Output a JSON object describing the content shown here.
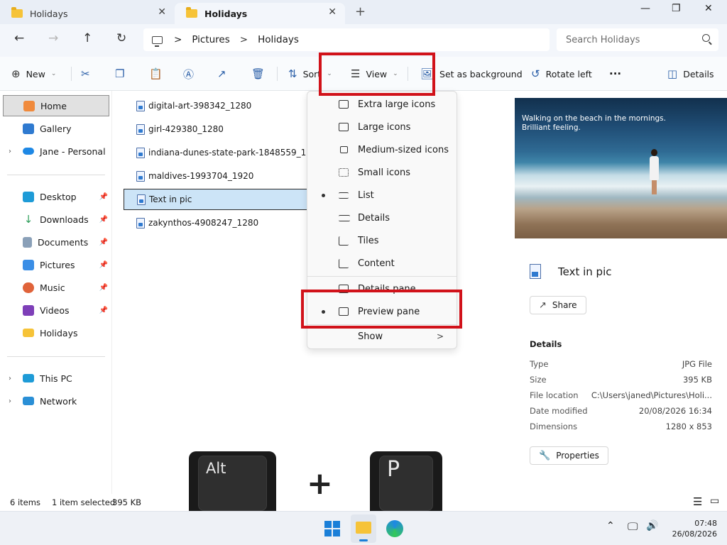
{
  "tabs": [
    {
      "label": "Holidays",
      "active": false
    },
    {
      "label": "Holidays",
      "active": true
    }
  ],
  "tab_controls": {
    "close": "✕",
    "new_tab": "+"
  },
  "window_controls": {
    "minimize": "—",
    "maximize": "❐",
    "close": "✕"
  },
  "nav": {
    "back": "←",
    "forward": "→",
    "up": "↑",
    "refresh": "↻"
  },
  "address": {
    "crumbs": [
      "Pictures",
      "Holidays"
    ],
    "separator": ">"
  },
  "search": {
    "placeholder": "Search Holidays"
  },
  "toolbar": {
    "new_label": "New",
    "sort_label": "Sort",
    "view_label": "View",
    "set_background_label": "Set as background",
    "rotate_left_label": "Rotate left",
    "more_label": "···",
    "details_label": "Details"
  },
  "sidebar": {
    "top": [
      {
        "label": "Home",
        "selected": true
      },
      {
        "label": "Gallery"
      },
      {
        "label": "Jane - Personal",
        "expandable": true
      }
    ],
    "quick_access": [
      {
        "label": "Desktop",
        "pinned": true
      },
      {
        "label": "Downloads",
        "pinned": true
      },
      {
        "label": "Documents",
        "pinned": true
      },
      {
        "label": "Pictures",
        "pinned": true
      },
      {
        "label": "Music",
        "pinned": true
      },
      {
        "label": "Videos",
        "pinned": true
      },
      {
        "label": "Holidays",
        "pinned": false
      }
    ],
    "bottom": [
      {
        "label": "This PC",
        "expandable": true
      },
      {
        "label": "Network",
        "expandable": true
      }
    ]
  },
  "files": [
    {
      "name": "digital-art-398342_1280"
    },
    {
      "name": "girl-429380_1280"
    },
    {
      "name": "indiana-dunes-state-park-1848559_1280"
    },
    {
      "name": "maldives-1993704_1920"
    },
    {
      "name": "Text in pic",
      "selected": true
    },
    {
      "name": "zakynthos-4908247_1280"
    }
  ],
  "view_menu": {
    "items": [
      {
        "label": "Extra large icons",
        "bullet": false
      },
      {
        "label": "Large icons",
        "bullet": false
      },
      {
        "label": "Medium-sized icons",
        "bullet": false
      },
      {
        "label": "Small icons",
        "bullet": false
      },
      {
        "label": "List",
        "bullet": true
      },
      {
        "label": "Details",
        "bullet": false
      },
      {
        "label": "Tiles",
        "bullet": false
      },
      {
        "label": "Content",
        "bullet": false
      }
    ],
    "panes": [
      {
        "label": "Details pane",
        "bullet": false
      },
      {
        "label": "Preview pane",
        "bullet": true
      }
    ],
    "show_label": "Show",
    "show_arrow": ">"
  },
  "preview": {
    "caption_line1": "Walking on the beach in the mornings.",
    "caption_line2": "Brilliant feeling.",
    "title": "Text in pic",
    "share_label": "Share",
    "details_heading": "Details",
    "properties": [
      {
        "key": "Type",
        "value": "JPG File"
      },
      {
        "key": "Size",
        "value": "395 KB"
      },
      {
        "key": "File location",
        "value": "C:\\Users\\janed\\Pictures\\Holi..."
      },
      {
        "key": "Date modified",
        "value": "20/08/2026 16:34"
      },
      {
        "key": "Dimensions",
        "value": "1280 x 853"
      }
    ],
    "properties_label": "Properties"
  },
  "keyhint": {
    "key1": "Alt",
    "plus": "+",
    "key2": "P"
  },
  "status": {
    "items": "6 items",
    "selected": "1 item selected",
    "size": "395 KB"
  },
  "taskbar": {
    "time": "07:48",
    "date": "26/08/2026"
  },
  "colors": {
    "highlight": "#d1121a",
    "selection": "#cce4f7",
    "accent": "#2b5fa8"
  }
}
